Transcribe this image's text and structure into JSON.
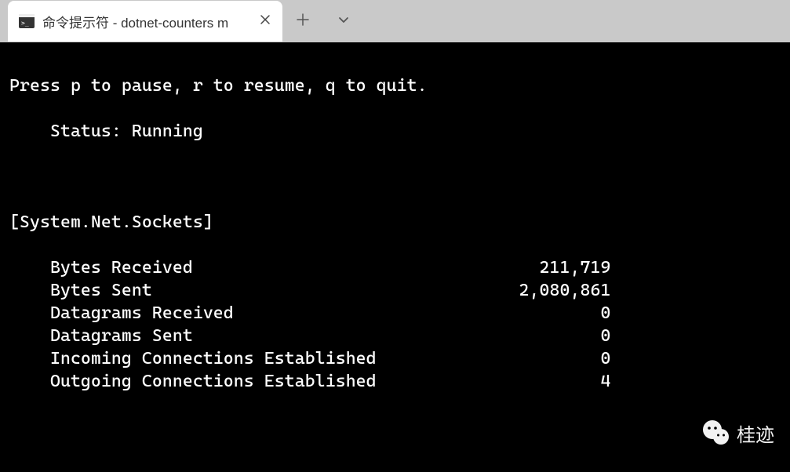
{
  "tab": {
    "title": "命令提示符 - dotnet-counters m"
  },
  "terminal": {
    "hint": "Press p to pause, r to resume, q to quit.",
    "status_line": "    Status: Running",
    "group": "[System.Net.Sockets]",
    "counters": [
      {
        "label": "Bytes Received",
        "value": "211,719"
      },
      {
        "label": "Bytes Sent",
        "value": "2,080,861"
      },
      {
        "label": "Datagrams Received",
        "value": "0"
      },
      {
        "label": "Datagrams Sent",
        "value": "0"
      },
      {
        "label": "Incoming Connections Established",
        "value": "0"
      },
      {
        "label": "Outgoing Connections Established",
        "value": "4"
      }
    ]
  },
  "watermark": {
    "text": "桂迹"
  }
}
